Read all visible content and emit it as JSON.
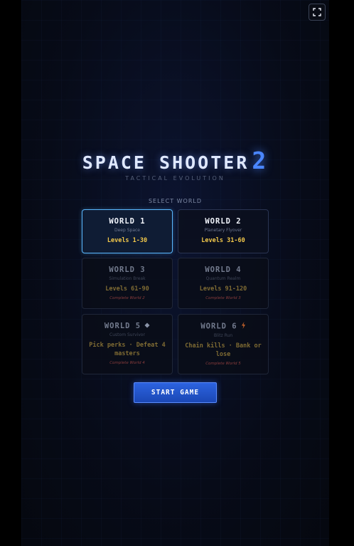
{
  "header": {
    "fullscreen_icon": "fullscreen-icon"
  },
  "title": {
    "main": "SPACE SHOOTER",
    "number": "2",
    "subtitle": "TACTICAL EVOLUTION"
  },
  "select_label": "SELECT WORLD",
  "worlds": [
    {
      "name": "WORLD 1",
      "subtitle": "Deep Space",
      "levels": "Levels 1-30",
      "lock_text": "",
      "state": "selected"
    },
    {
      "name": "WORLD 2",
      "subtitle": "Planetary Flyover",
      "levels": "Levels 31-60",
      "lock_text": "",
      "state": "unlocked"
    },
    {
      "name": "WORLD 3",
      "subtitle": "Simulation Break",
      "levels": "Levels 61-90",
      "lock_text": "Complete World 2",
      "state": "locked"
    },
    {
      "name": "WORLD 4",
      "subtitle": "Quantum Realm",
      "levels": "Levels 91-120",
      "lock_text": "Complete World 3",
      "state": "locked"
    },
    {
      "name": "WORLD 5",
      "subtitle": "Custom Survivor",
      "levels": "Pick perks · Defeat 4 masters",
      "lock_text": "Complete World 4",
      "state": "locked",
      "icon": "diamond-icon"
    },
    {
      "name": "WORLD 6",
      "subtitle": "Blitz Run",
      "levels": "Chain kills · Bank or lose",
      "lock_text": "Complete World 5",
      "state": "locked",
      "icon": "lightning-icon"
    }
  ],
  "start_button": "START GAME",
  "colors": {
    "accent": "#4a86ff",
    "selected_border": "#5ab8ff",
    "levels_text": "#f2c84b",
    "lock_text": "#8a3d3d"
  }
}
